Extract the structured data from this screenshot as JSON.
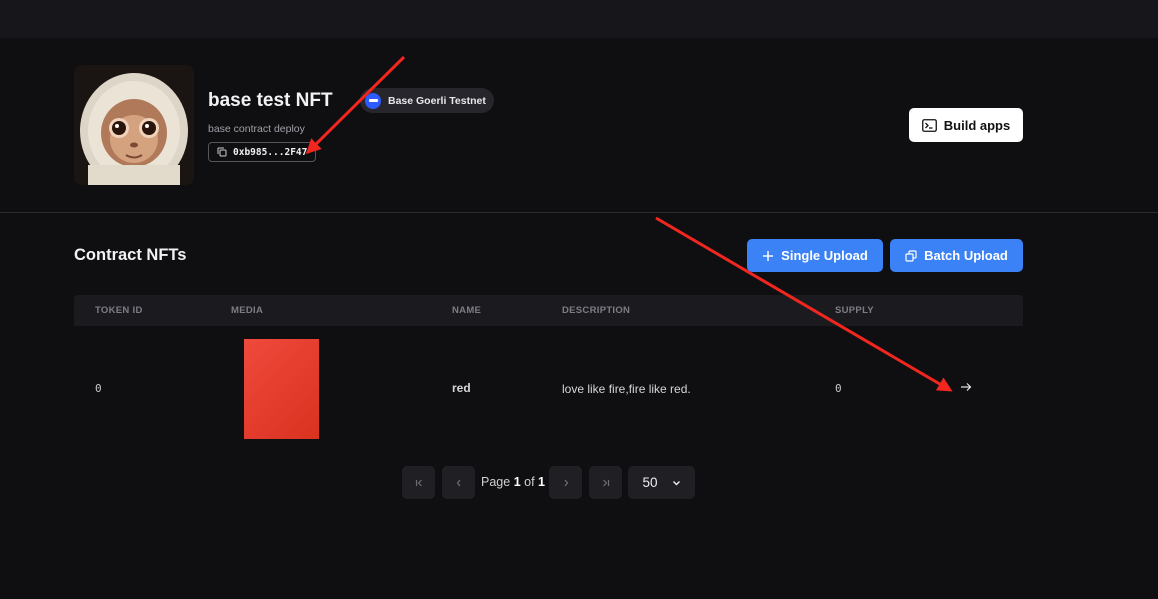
{
  "contract": {
    "title": "base test NFT",
    "chain": "Base Goerli Testnet",
    "description": "base contract deploy",
    "address": "0xb985...2F47",
    "build_label": "Build apps"
  },
  "section": {
    "title": "Contract NFTs",
    "single_upload": "Single Upload",
    "batch_upload": "Batch Upload"
  },
  "table": {
    "columns": [
      "TOKEN ID",
      "MEDIA",
      "NAME",
      "DESCRIPTION",
      "SUPPLY"
    ],
    "rows": [
      {
        "token_id": "0",
        "media_color": "#e63d2e",
        "name": "red",
        "description": "love like fire,fire like red.",
        "supply": "0"
      }
    ]
  },
  "pagination": {
    "page_word": "Page",
    "current": "1",
    "of_word": "of",
    "total": "1",
    "page_size": "50"
  },
  "colors": {
    "accent_blue": "#3b82f6",
    "annotation_red": "#f0261f",
    "chain_blue": "#2d5bff"
  }
}
